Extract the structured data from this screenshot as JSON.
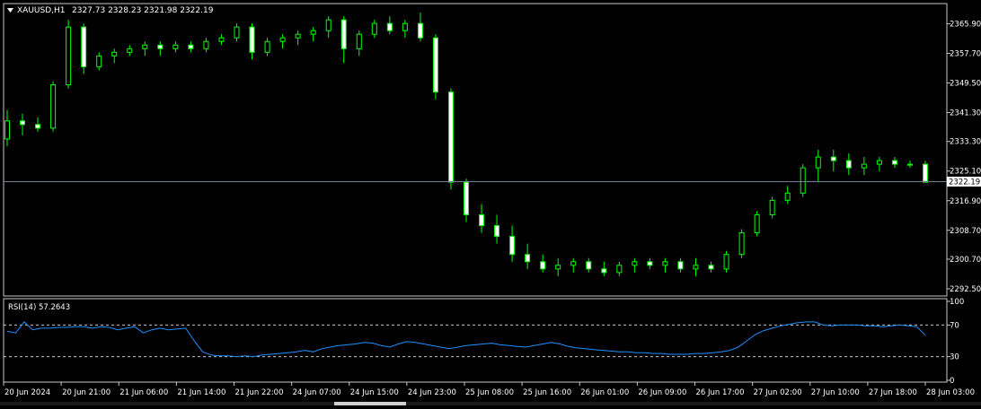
{
  "header": {
    "symbol": "XAUUSD,H1",
    "ohlc": "2327.73 2328.23 2321.98 2322.19",
    "triangle_icon": "triangle-down-icon"
  },
  "colors": {
    "background": "#000000",
    "frame": "#c8c8c8",
    "bull": "#00ff00",
    "bear": "#ffffff",
    "rsi_line": "#1e90ff",
    "price_line": "#708090",
    "text": "#ffffff"
  },
  "price_axis": {
    "labels": [
      "2365.90",
      "2357.70",
      "2349.50",
      "2341.30",
      "2333.30",
      "2325.10",
      "2316.90",
      "2308.70",
      "2300.70",
      "2292.50"
    ],
    "current_price": "2322.19"
  },
  "rsi_panel": {
    "label": "RSI(14) 57.2643",
    "axis_labels": [
      "100",
      "70",
      "30",
      "0"
    ],
    "levels": [
      70,
      30
    ]
  },
  "time_axis": {
    "labels": [
      "20 Jun 2024",
      "20 Jun 21:00",
      "21 Jun 06:00",
      "21 Jun 14:00",
      "21 Jun 22:00",
      "24 Jun 07:00",
      "24 Jun 15:00",
      "24 Jun 23:00",
      "25 Jun 08:00",
      "25 Jun 16:00",
      "26 Jun 01:00",
      "26 Jun 09:00",
      "26 Jun 17:00",
      "27 Jun 02:00",
      "27 Jun 10:00",
      "27 Jun 18:00",
      "28 Jun 03:00"
    ]
  },
  "chart_data": [
    {
      "type": "candlestick",
      "title": "XAUUSD,H1",
      "ylim": [
        2291,
        2371
      ],
      "candles": [
        [
          2334,
          2342,
          2332,
          2339
        ],
        [
          2339,
          2341,
          2335,
          2338
        ],
        [
          2338,
          2340,
          2336,
          2337
        ],
        [
          2337,
          2350,
          2336,
          2349
        ],
        [
          2349,
          2367,
          2348,
          2365
        ],
        [
          2365,
          2366,
          2352,
          2354
        ],
        [
          2354,
          2358,
          2353,
          2357
        ],
        [
          2357,
          2359,
          2355,
          2358
        ],
        [
          2358,
          2360,
          2357,
          2359
        ],
        [
          2359,
          2361,
          2357,
          2360
        ],
        [
          2360,
          2361,
          2357,
          2359
        ],
        [
          2359,
          2361,
          2358,
          2360
        ],
        [
          2360,
          2361,
          2358,
          2359
        ],
        [
          2359,
          2362,
          2358,
          2361
        ],
        [
          2361,
          2363,
          2360,
          2362
        ],
        [
          2362,
          2366,
          2361,
          2365
        ],
        [
          2365,
          2366,
          2356,
          2358
        ],
        [
          2358,
          2362,
          2357,
          2361
        ],
        [
          2361,
          2363,
          2359,
          2362
        ],
        [
          2362,
          2364,
          2360,
          2363
        ],
        [
          2363,
          2365,
          2361,
          2364
        ],
        [
          2364,
          2368,
          2362,
          2367
        ],
        [
          2367,
          2368,
          2355,
          2359
        ],
        [
          2359,
          2364,
          2357,
          2363
        ],
        [
          2363,
          2367,
          2362,
          2366
        ],
        [
          2366,
          2368,
          2363,
          2364
        ],
        [
          2364,
          2367,
          2362,
          2366
        ],
        [
          2366,
          2369,
          2361,
          2362
        ],
        [
          2362,
          2363,
          2345,
          2347
        ],
        [
          2347,
          2348,
          2320,
          2322
        ],
        [
          2322,
          2323,
          2311,
          2313
        ],
        [
          2313,
          2316,
          2308,
          2310
        ],
        [
          2310,
          2313,
          2305,
          2307
        ],
        [
          2307,
          2310,
          2300,
          2302
        ],
        [
          2302,
          2305,
          2298,
          2300
        ],
        [
          2300,
          2302,
          2297,
          2298
        ],
        [
          2298,
          2301,
          2296,
          2299
        ],
        [
          2299,
          2301,
          2297,
          2300
        ],
        [
          2300,
          2301,
          2297,
          2298
        ],
        [
          2298,
          2300,
          2296,
          2297
        ],
        [
          2297,
          2300,
          2296,
          2299
        ],
        [
          2299,
          2301,
          2297,
          2300
        ],
        [
          2300,
          2301,
          2298,
          2299
        ],
        [
          2299,
          2301,
          2297,
          2300
        ],
        [
          2300,
          2301,
          2297,
          2298
        ],
        [
          2298,
          2301,
          2296,
          2299
        ],
        [
          2299,
          2300,
          2297,
          2298
        ],
        [
          2298,
          2303,
          2297,
          2302
        ],
        [
          2302,
          2309,
          2301,
          2308
        ],
        [
          2308,
          2314,
          2307,
          2313
        ],
        [
          2313,
          2318,
          2312,
          2317
        ],
        [
          2317,
          2321,
          2316,
          2319
        ],
        [
          2319,
          2327,
          2318,
          2326
        ],
        [
          2326,
          2331,
          2322,
          2329
        ],
        [
          2329,
          2331,
          2325,
          2328
        ],
        [
          2328,
          2330,
          2324,
          2326
        ],
        [
          2326,
          2329,
          2324,
          2327
        ],
        [
          2327,
          2329,
          2325,
          2328
        ],
        [
          2328,
          2329,
          2326,
          2327
        ],
        [
          2327,
          2328,
          2326,
          2327
        ],
        [
          2327,
          2328,
          2322,
          2322
        ]
      ]
    },
    {
      "type": "line",
      "title": "RSI(14) 57.2643",
      "ylim": [
        0,
        100
      ],
      "series": [
        {
          "values": [
            62,
            60,
            74,
            64,
            66,
            66,
            67,
            67,
            68,
            68,
            66,
            68,
            67,
            64,
            66,
            68,
            60,
            64,
            66,
            64,
            65,
            66,
            50,
            36,
            32,
            31,
            31,
            30,
            31,
            30,
            32,
            33,
            34,
            35,
            36,
            38,
            36,
            40,
            42,
            44,
            45,
            46,
            48,
            47,
            44,
            42,
            46,
            49,
            48,
            46,
            44,
            42,
            40,
            42,
            44,
            45,
            46,
            47,
            45,
            44,
            43,
            42,
            44,
            46,
            48,
            46,
            43,
            41,
            40,
            39,
            38,
            37,
            36,
            36,
            35,
            35,
            34,
            34,
            33,
            33,
            33,
            34,
            34,
            35,
            36,
            38,
            42,
            50,
            58,
            63,
            66,
            69,
            71,
            73,
            74,
            74,
            70,
            69,
            70,
            70,
            70,
            69,
            69,
            68,
            69,
            70,
            69,
            68,
            57
          ]
        }
      ],
      "levels": [
        70,
        30
      ]
    }
  ]
}
